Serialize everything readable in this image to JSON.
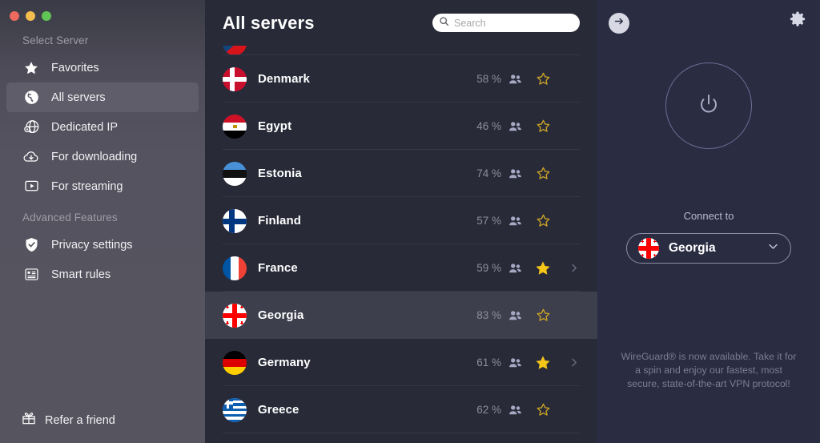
{
  "window": {
    "traffic_lights": [
      "close",
      "minimize",
      "maximize"
    ]
  },
  "sidebar": {
    "sections": [
      {
        "label": "Select Server",
        "items": [
          {
            "label": "Favorites",
            "icon": "star-icon",
            "active": false
          },
          {
            "label": "All servers",
            "icon": "globe-icon",
            "active": true
          },
          {
            "label": "Dedicated IP",
            "icon": "dedicated-ip-icon",
            "active": false
          },
          {
            "label": "For downloading",
            "icon": "cloud-download-icon",
            "active": false
          },
          {
            "label": "For streaming",
            "icon": "streaming-icon",
            "active": false
          }
        ]
      },
      {
        "label": "Advanced Features",
        "items": [
          {
            "label": "Privacy settings",
            "icon": "shield-check-icon",
            "active": false
          },
          {
            "label": "Smart rules",
            "icon": "rules-list-icon",
            "active": false
          }
        ]
      }
    ],
    "footer": {
      "label": "Refer a friend",
      "icon": "gift-icon"
    }
  },
  "main": {
    "title": "All servers",
    "search": {
      "value": "",
      "placeholder": "Search",
      "icon": "search-icon"
    },
    "servers": [
      {
        "name": "",
        "load": "",
        "flag": "czech",
        "favorite": true,
        "expandable": true,
        "highlight": false,
        "partial": true
      },
      {
        "name": "Denmark",
        "load": "58 %",
        "flag": "denmark",
        "favorite": false,
        "expandable": false,
        "highlight": false,
        "partial": false
      },
      {
        "name": "Egypt",
        "load": "46 %",
        "flag": "egypt",
        "favorite": false,
        "expandable": false,
        "highlight": false,
        "partial": false
      },
      {
        "name": "Estonia",
        "load": "74 %",
        "flag": "estonia",
        "favorite": false,
        "expandable": false,
        "highlight": false,
        "partial": false
      },
      {
        "name": "Finland",
        "load": "57 %",
        "flag": "finland",
        "favorite": false,
        "expandable": false,
        "highlight": false,
        "partial": false
      },
      {
        "name": "France",
        "load": "59 %",
        "flag": "france",
        "favorite": true,
        "expandable": true,
        "highlight": false,
        "partial": false
      },
      {
        "name": "Georgia",
        "load": "83 %",
        "flag": "georgia",
        "favorite": false,
        "expandable": false,
        "highlight": true,
        "partial": false
      },
      {
        "name": "Germany",
        "load": "61 %",
        "flag": "germany",
        "favorite": true,
        "expandable": true,
        "highlight": false,
        "partial": false
      },
      {
        "name": "Greece",
        "load": "62 %",
        "flag": "greece",
        "favorite": false,
        "expandable": false,
        "highlight": false,
        "partial": false
      }
    ]
  },
  "right_panel": {
    "back_icon": "arrow-right-circle-icon",
    "settings_icon": "gear-icon",
    "power_icon": "power-icon",
    "connect_label": "Connect to",
    "selected_server": {
      "name": "Georgia",
      "flag": "georgia"
    },
    "dropdown_icon": "chevron-down-icon",
    "promo_text": "WireGuard® is now available. Take it for a spin and enjoy our fastest, most secure, state-of-the-art VPN protocol!"
  },
  "colors": {
    "sidebar_bg": "#56545F",
    "list_bg": "#282A38",
    "right_bg": "#2A2C42",
    "highlight_row": "#3D3F4D",
    "star_gold": "#F5C518",
    "star_outline": "#C9A227",
    "people_icon": "#A7A9C4",
    "load_text": "#8D8E9B"
  }
}
